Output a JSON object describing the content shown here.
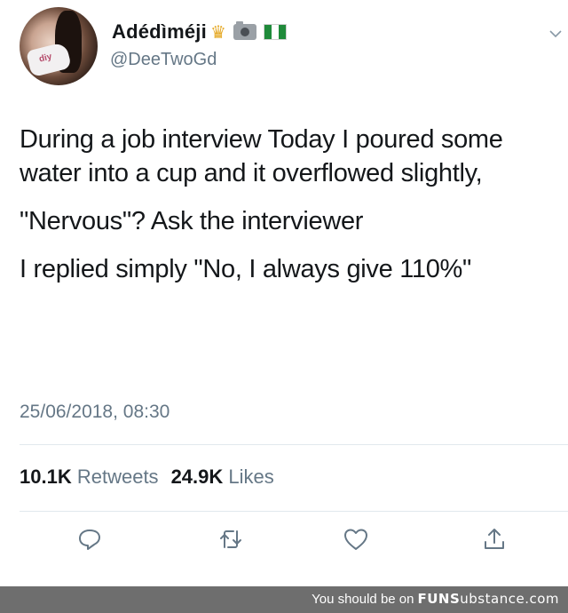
{
  "tweet": {
    "display_name": "Adédìméji",
    "badges": [
      "crown-emoji",
      "camera-emoji",
      "nigeria-flag-emoji"
    ],
    "handle": "@DeeTwoGd",
    "avatar_shirt_text": "diy",
    "paragraphs": [
      "During a job interview Today I poured some water into a cup and it overflowed slightly,",
      "\"Nervous\"? Ask the interviewer",
      "I replied simply \"No, I always give 110%\""
    ],
    "timestamp": "25/06/2018, 08:30",
    "stats": {
      "retweets_count": "10.1K",
      "retweets_label": "Retweets",
      "likes_count": "24.9K",
      "likes_label": "Likes"
    },
    "actions": [
      "reply-icon",
      "retweet-icon",
      "like-icon",
      "share-icon"
    ]
  },
  "footer": {
    "prefix": "You should be on",
    "brand_main": "FUNS",
    "brand_sub": "ubstance",
    "brand_tld": ".com"
  },
  "colors": {
    "text_primary": "#14171a",
    "text_secondary": "#657786",
    "divider": "#e1e8ed",
    "footer_bg": "#6e6e6e"
  }
}
